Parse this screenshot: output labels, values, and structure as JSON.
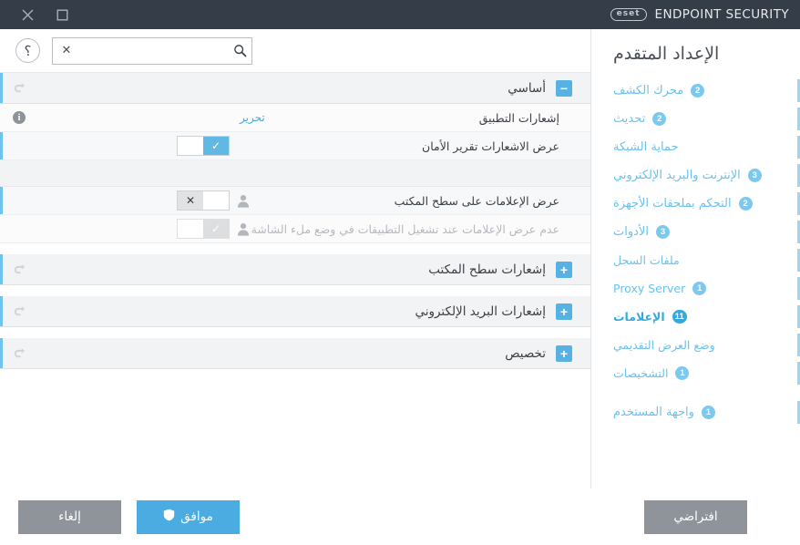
{
  "titlebar": {
    "close_label": "✕",
    "maximize_label": "□",
    "brand_mark": "eset",
    "brand_text": "ENDPOINT SECURITY"
  },
  "toolbar": {
    "help_label": "؟",
    "search_value": "",
    "search_placeholder": "",
    "search_clear_label": "✕"
  },
  "sidebar": {
    "title": "الإعداد المتقدم",
    "items": [
      {
        "label": "محرك الكشف",
        "badge": "2",
        "active": false,
        "sub": false
      },
      {
        "label": "تحديث",
        "badge": "2",
        "active": false,
        "sub": false
      },
      {
        "label": "حماية الشبكة",
        "badge": "",
        "active": false,
        "sub": false
      },
      {
        "label": "الإنترنت والبريد الإلكتروني",
        "badge": "3",
        "active": false,
        "sub": false
      },
      {
        "label": "التحكم بملحقات الأجهزة",
        "badge": "2",
        "active": false,
        "sub": false
      },
      {
        "label": "الأدوات",
        "badge": "3",
        "active": false,
        "sub": false
      },
      {
        "label": "ملفات السجل",
        "badge": "",
        "active": false,
        "sub": true
      },
      {
        "label": "Proxy Server",
        "badge": "1",
        "active": false,
        "sub": true
      },
      {
        "label": "الإعلامات",
        "badge": "11",
        "active": true,
        "sub": true
      },
      {
        "label": "وضع العرض التقديمي",
        "badge": "",
        "active": false,
        "sub": true
      },
      {
        "label": "التشخيصات",
        "badge": "1",
        "active": false,
        "sub": true
      },
      {
        "label": "واجهة المستخدم",
        "badge": "1",
        "active": false,
        "sub": false,
        "spaced": true
      }
    ]
  },
  "settings": {
    "sections": [
      {
        "title": "أساسي",
        "toggle_label": "−",
        "expanded": true,
        "rows": [
          {
            "kind": "link",
            "label": "إشعارات التطبيق",
            "link_label": "تحرير",
            "info": true,
            "accent": false,
            "dim": false
          },
          {
            "kind": "switch",
            "label": "عرض الاشعارات تقرير الأمان",
            "state": "on",
            "state_label": "✓",
            "user_icon": false,
            "accent": true,
            "dim": false,
            "disabled": false
          },
          {
            "kind": "blank"
          },
          {
            "kind": "switch",
            "label": "عرض الإعلامات على سطح المكتب",
            "state": "off",
            "state_label": "✕",
            "user_icon": true,
            "accent": true,
            "dim": false,
            "disabled": false
          },
          {
            "kind": "switch",
            "label": "عدم عرض الإعلامات عند تشغيل التطبيقات في وضع ملء الشاشة",
            "state": "on",
            "state_label": "✓",
            "user_icon": true,
            "accent": false,
            "dim": true,
            "disabled": true
          }
        ]
      },
      {
        "title": "إشعارات سطح المكتب",
        "toggle_label": "+",
        "expanded": false,
        "rows": []
      },
      {
        "title": "إشعارات البريد الإلكتروني",
        "toggle_label": "+",
        "expanded": false,
        "rows": []
      },
      {
        "title": "تخصيص",
        "toggle_label": "+",
        "expanded": false,
        "rows": []
      }
    ]
  },
  "footer": {
    "cancel_label": "إلغاء",
    "ok_label": "موافق",
    "default_label": "افتراضي"
  },
  "colors": {
    "accent": "#57b2e3",
    "sidebar_link": "#6cc1ec",
    "titlebar": "#353d48",
    "grey_button": "#8e949a"
  }
}
